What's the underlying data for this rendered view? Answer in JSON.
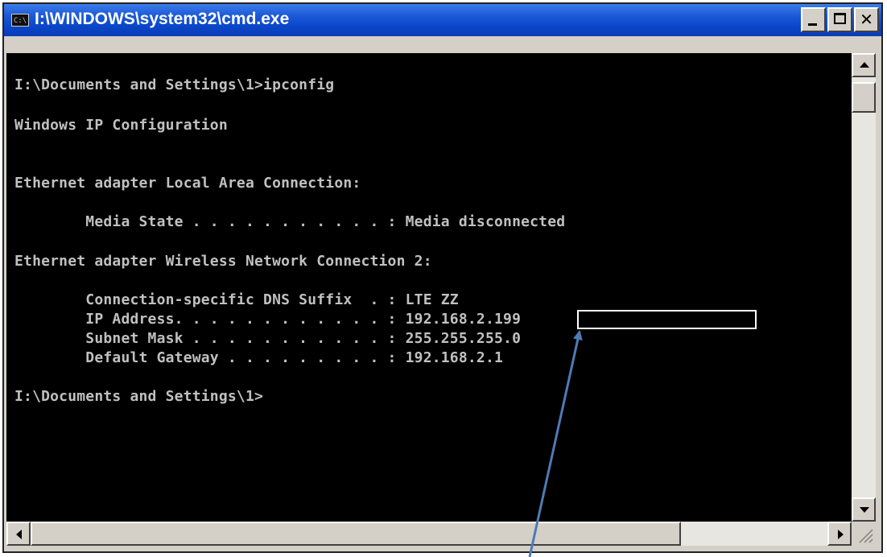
{
  "window": {
    "title": "I:\\WINDOWS\\system32\\cmd.exe",
    "icon_label": "C:\\",
    "buttons": [
      "minimize",
      "maximize",
      "close"
    ],
    "close_glyph": "✕"
  },
  "console": {
    "lines": [
      "I:\\Documents and Settings\\1>ipconfig",
      "Windows IP Configuration",
      "Ethernet adapter Local Area Connection:",
      "        Media State . . . . . . . . . . . : Media disconnected",
      "Ethernet adapter Wireless Network Connection 2:",
      "        Connection-specific DNS Suffix  . : LTE ZZ",
      "        IP Address. . . . . . . . . . . . : 192.168.2.199",
      "        Subnet Mask . . . . . . . . . . . : 255.255.255.0",
      "        Default Gateway . . . . . . . . . : 192.168.2.1",
      "I:\\Documents and Settings\\1>"
    ]
  },
  "annotation": {
    "highlighted_value": "192.168.2.199",
    "highlight_color": "#ffffff",
    "arrow_color": "#4f7ab5"
  },
  "colors": {
    "titlebar": "#0a46c8",
    "console_bg": "#000000",
    "console_text": "#c0c0c0",
    "chrome": "#d4d0c8"
  }
}
